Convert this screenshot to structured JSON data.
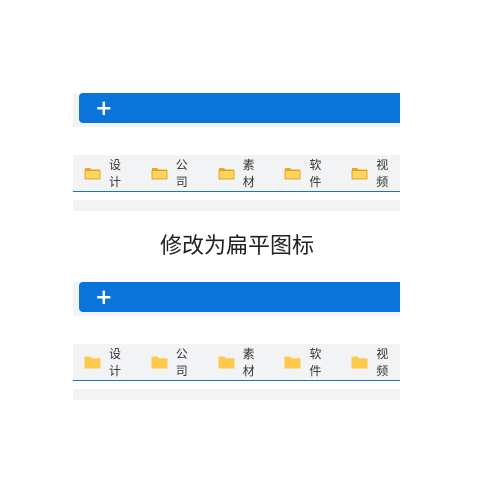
{
  "top_panel": {
    "add_symbol": "+",
    "folders": [
      {
        "label": "设计",
        "icon": "folder-icon-3d"
      },
      {
        "label": "公司",
        "icon": "folder-icon-3d"
      },
      {
        "label": "素材",
        "icon": "folder-icon-3d"
      },
      {
        "label": "软件",
        "icon": "folder-icon-3d"
      },
      {
        "label": "视频",
        "icon": "folder-icon-3d"
      }
    ]
  },
  "caption": "修改为扁平图标",
  "bottom_panel": {
    "add_symbol": "+",
    "folders": [
      {
        "label": "设计",
        "icon": "folder-icon-flat"
      },
      {
        "label": "公司",
        "icon": "folder-icon-flat"
      },
      {
        "label": "素材",
        "icon": "folder-icon-flat"
      },
      {
        "label": "软件",
        "icon": "folder-icon-flat"
      },
      {
        "label": "视频",
        "icon": "folder-icon-flat"
      }
    ]
  },
  "colors": {
    "accent_blue": "#0a74da",
    "folder_yellow": "#ffc94d",
    "panel_gray": "#f2f3f5"
  }
}
